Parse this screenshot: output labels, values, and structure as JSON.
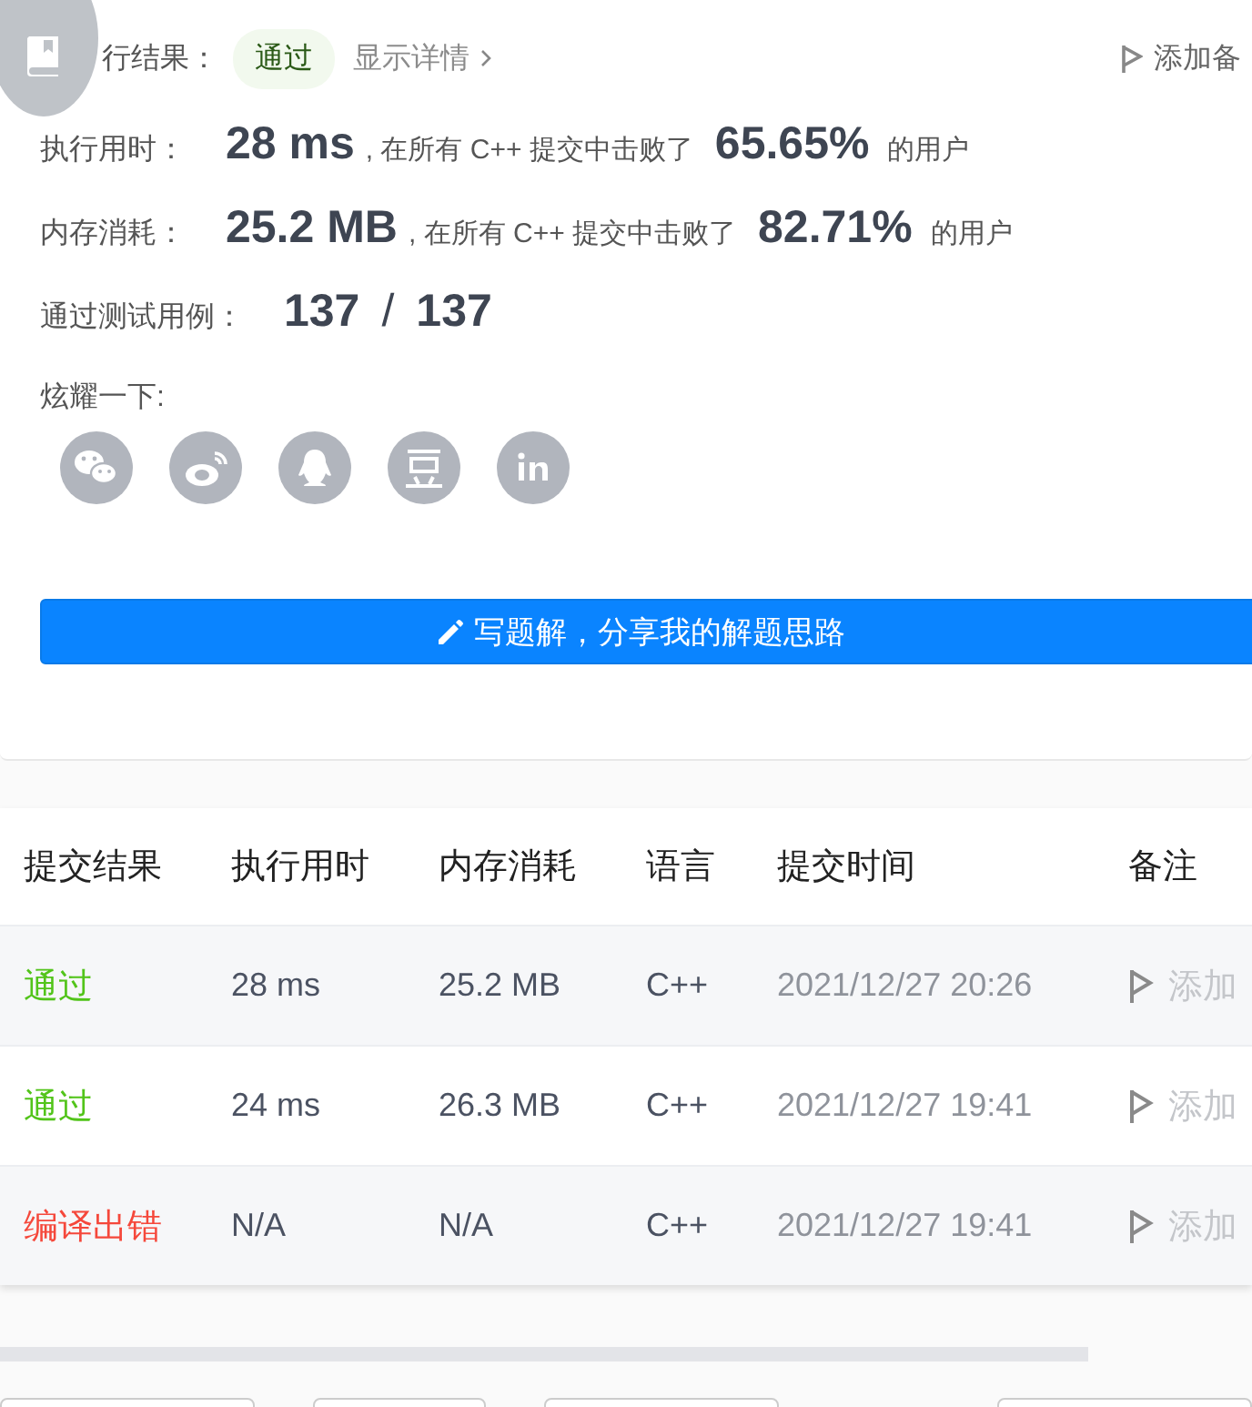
{
  "result": {
    "label": "行结果：",
    "status": "通过",
    "details_link": "显示详情",
    "note_link": "添加备"
  },
  "stats": [
    {
      "label": "执行用时：",
      "value": "28 ms",
      "middle": ", 在所有 C++ 提交中击败了",
      "percent": "65.65%",
      "suffix": "的用户"
    },
    {
      "label": "内存消耗：",
      "value": "25.2 MB",
      "middle": ", 在所有 C++ 提交中击败了",
      "percent": "82.71%",
      "suffix": "的用户"
    }
  ],
  "testcases": {
    "label": "通过测试用例：",
    "passed": "137",
    "separator": "/",
    "total": "137"
  },
  "share": {
    "label": "炫耀一下:",
    "icons": [
      {
        "kind": "wechat"
      },
      {
        "kind": "weibo"
      },
      {
        "kind": "qq"
      },
      {
        "kind": "douban"
      },
      {
        "kind": "linkedin"
      }
    ]
  },
  "write_button": "写题解，分享我的解题思路",
  "table": {
    "columns": [
      "提交结果",
      "执行用时",
      "内存消耗",
      "语言",
      "提交时间",
      "备注"
    ],
    "rows": [
      {
        "result": "通过",
        "color": "#52c41a",
        "time": "28 ms",
        "memory": "25.2 MB",
        "language": "C++",
        "submitted": "2021/12/27 20:26",
        "note": "添加"
      },
      {
        "result": "通过",
        "color": "#52c41a",
        "time": "24 ms",
        "memory": "26.3 MB",
        "language": "C++",
        "submitted": "2021/12/27 19:41",
        "note": "添加"
      },
      {
        "result": "编译出错",
        "color": "#f5483b",
        "time": "N/A",
        "memory": "N/A",
        "language": "C++",
        "submitted": "2021/12/27 19:41",
        "note": "添加"
      }
    ]
  }
}
